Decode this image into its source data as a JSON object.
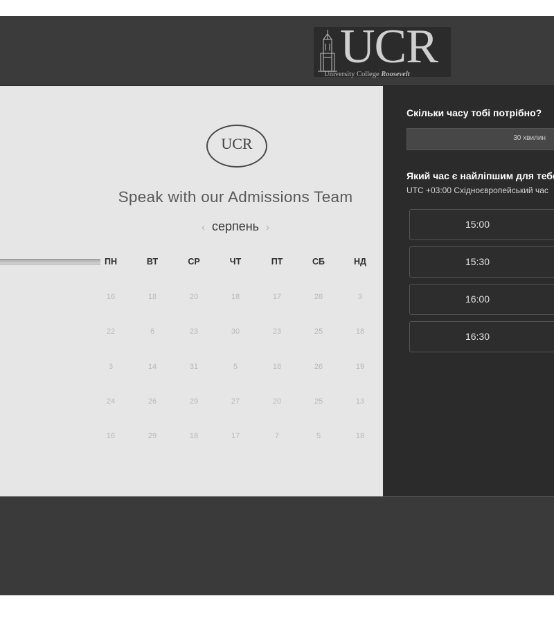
{
  "header": {
    "logo_text": "UCR",
    "logo_subtitle": "University College",
    "logo_subtitle_italic": "Roosevelt"
  },
  "calendar": {
    "badge_text": "UCR",
    "title": "Speak with our Admissions Team",
    "month": "серпень",
    "prev_icon": "chevron-left-icon",
    "next_icon": "chevron-right-icon",
    "weekdays": [
      "ПН",
      "ВТ",
      "СР",
      "ЧТ",
      "ПТ",
      "СБ",
      "НД"
    ],
    "weeks": [
      [
        "16",
        "18",
        "20",
        "18",
        "17",
        "28",
        "3"
      ],
      [
        "22",
        "6",
        "23",
        "30",
        "23",
        "25",
        "18"
      ],
      [
        "3",
        "14",
        "31",
        "5",
        "18",
        "26",
        "19"
      ],
      [
        "24",
        "26",
        "29",
        "27",
        "20",
        "25",
        "13"
      ],
      [
        "16",
        "29",
        "18",
        "17",
        "7",
        "5",
        "18"
      ]
    ]
  },
  "booking": {
    "duration_question": "Скільки часу тобі потрібно?",
    "duration_value": "30 хвилин",
    "time_question": "Який час є найліпшим для тебе?",
    "timezone": "UTC +03:00 Східноєвропейський час",
    "slots": [
      "15:00",
      "15:30",
      "16:00",
      "16:30"
    ]
  },
  "colors": {
    "header_bg": "#3b3b3b",
    "calendar_bg": "#e6e6e6",
    "side_panel_bg": "#2b2b2b"
  }
}
